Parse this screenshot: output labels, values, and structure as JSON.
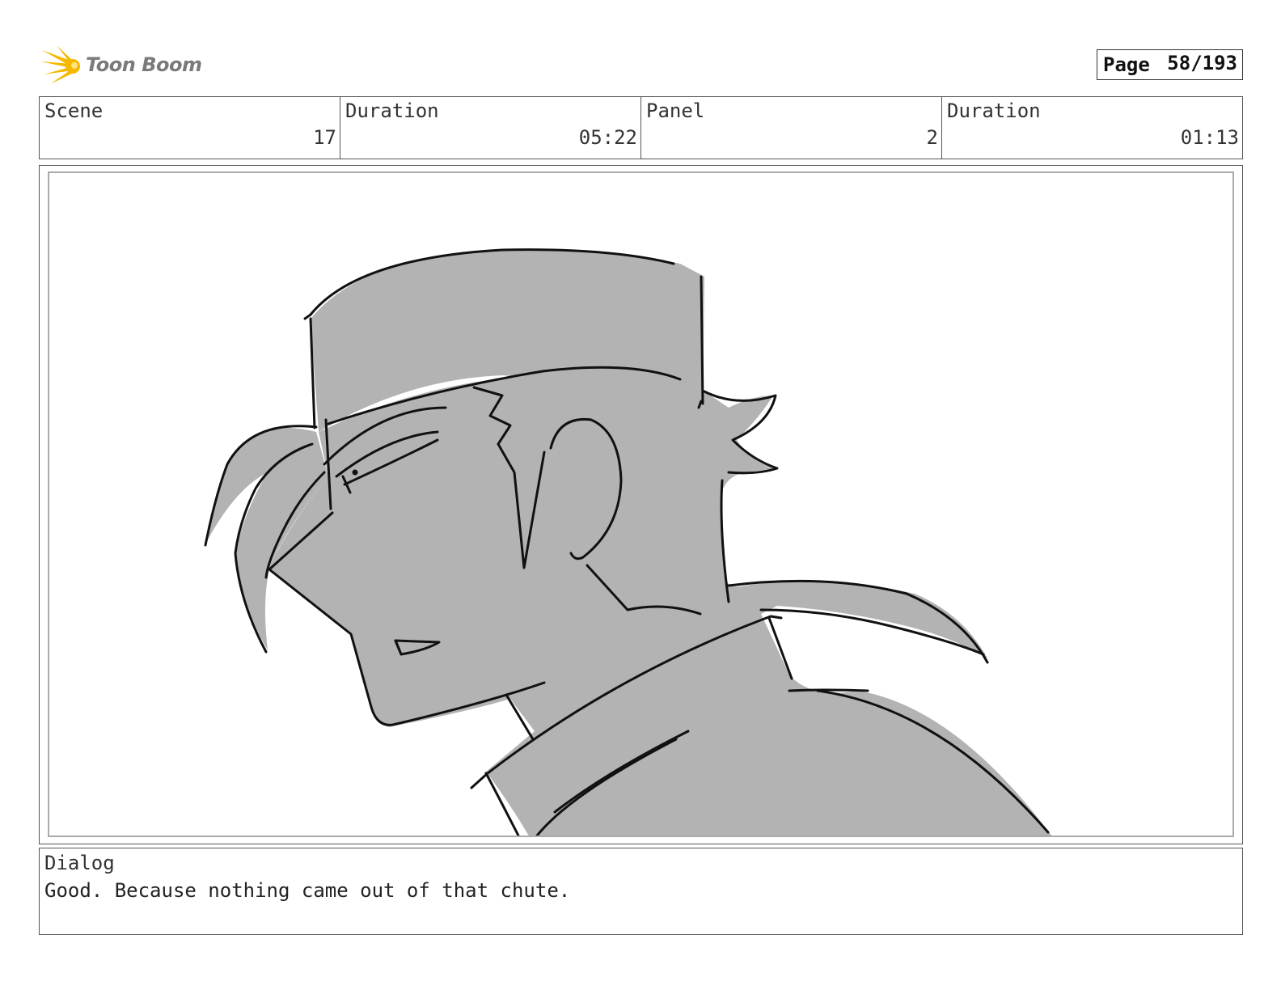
{
  "header": {
    "logo_text": "Toon Boom",
    "page_label": "Page",
    "page_value": "58/193"
  },
  "info": {
    "scene_label": "Scene",
    "scene_value": "17",
    "scene_duration_label": "Duration",
    "scene_duration_value": "05:22",
    "panel_label": "Panel",
    "panel_value": "2",
    "panel_duration_label": "Duration",
    "panel_duration_value": "01:13"
  },
  "dialog": {
    "label": "Dialog",
    "text": "Good. Because nothing came out of that chute."
  },
  "colors": {
    "sketch_fill": "#b3b3b3",
    "sketch_line": "#111111",
    "logo_yellow": "#f5b800"
  }
}
